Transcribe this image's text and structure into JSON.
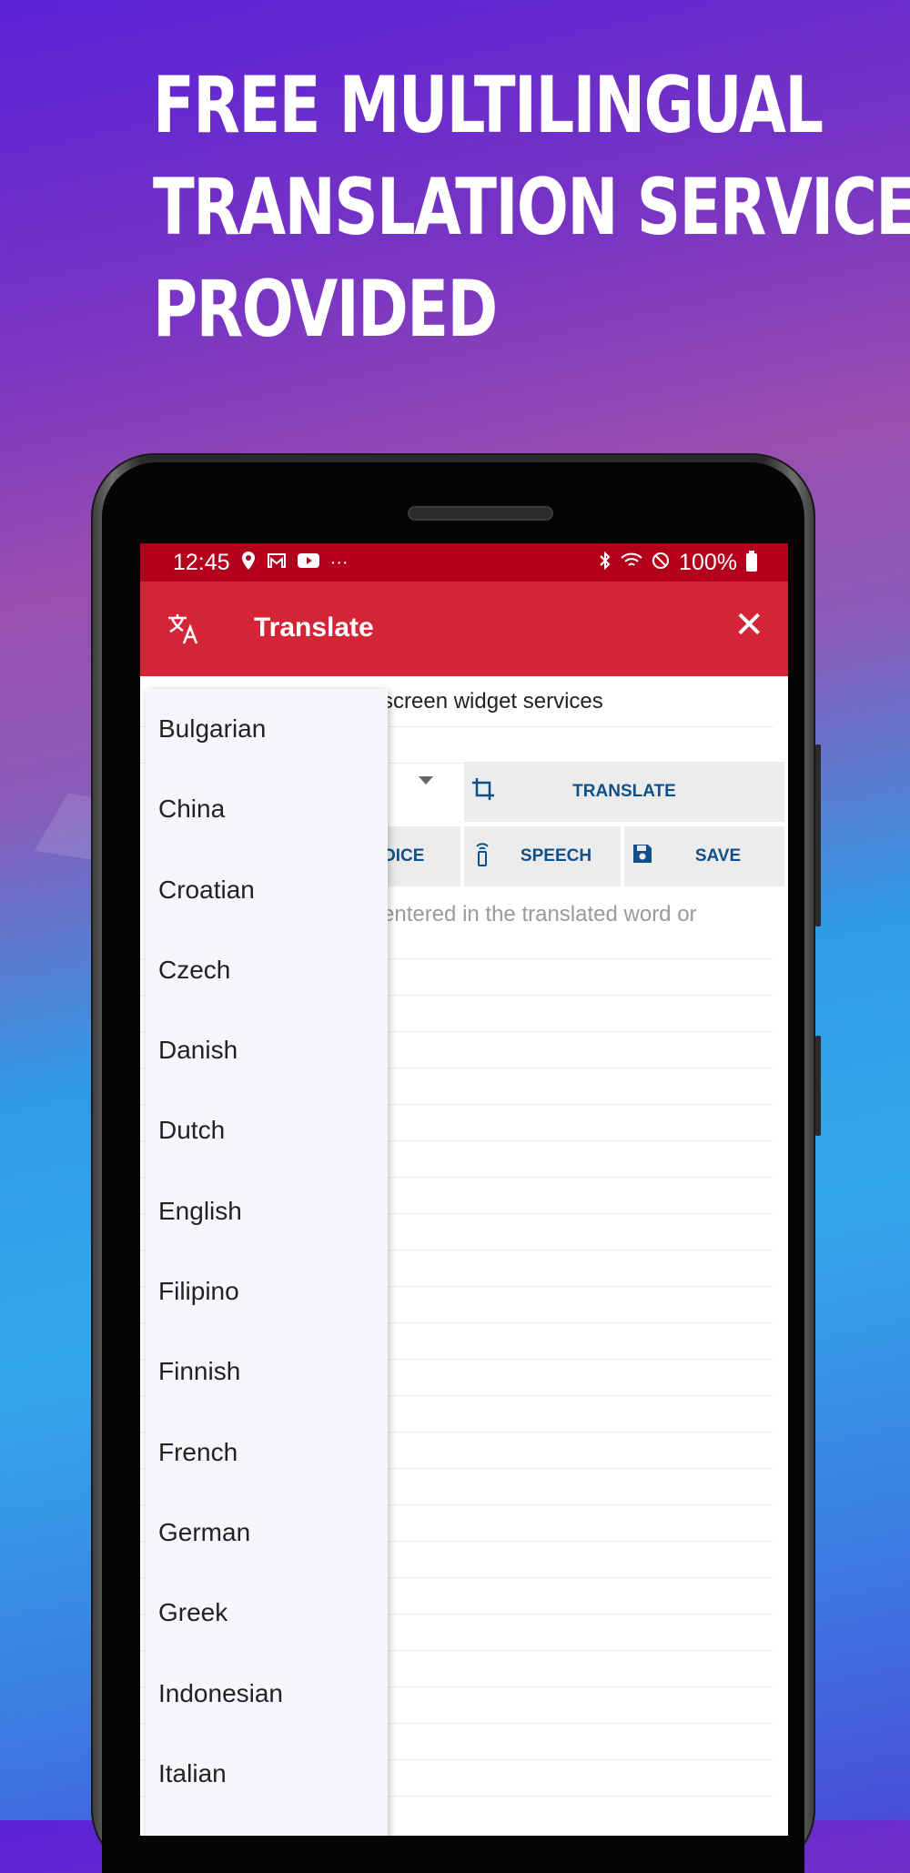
{
  "promo": {
    "headline_lines": [
      "FREE MULTILINGUAL",
      "TRANSLATION SERVICE",
      "PROVIDED"
    ]
  },
  "status_bar": {
    "time": "12:45",
    "left_icons": [
      "location-icon",
      "gmail-icon",
      "youtube-icon",
      "more-dots-icon"
    ],
    "battery_text": "100%",
    "right_icons": [
      "bluetooth-icon",
      "wifi-icon",
      "do-not-disturb-icon",
      "battery-icon"
    ]
  },
  "app_bar": {
    "title": "Translate",
    "icon": "translate-icon",
    "close_icon": "close-icon",
    "background": "#d32535"
  },
  "input": {
    "visible_text": "screen widget services"
  },
  "buttons": {
    "translate": "TRANSLATE",
    "voice": "OICE",
    "speech": "SPEECH",
    "save": "SAVE"
  },
  "output": {
    "placeholder": "entered in the translated word or"
  },
  "language_dropdown": {
    "items": [
      "Bulgarian",
      "China",
      "Croatian",
      "Czech",
      "Danish",
      "Dutch",
      "English",
      "Filipino",
      "Finnish",
      "French",
      "German",
      "Greek",
      "Indonesian",
      "Italian"
    ]
  },
  "colors": {
    "status_bar": "#b3001b",
    "accent": "#d32535",
    "button_text": "#0f4f8c"
  }
}
